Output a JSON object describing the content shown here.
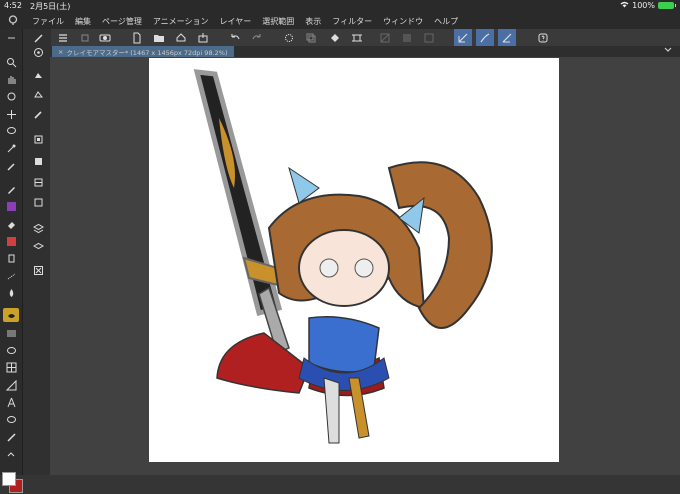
{
  "status": {
    "time": "4:52",
    "date": "2月5日(土)",
    "battery": "100%"
  },
  "menu": {
    "items": [
      "ファイル",
      "編集",
      "ページ管理",
      "アニメーション",
      "レイヤー",
      "選択範囲",
      "表示",
      "フィルター",
      "ウィンドウ",
      "ヘルプ"
    ]
  },
  "tab": {
    "title": "クレイモアマスター* (1467 x 1456px 72dpi 98.2%)"
  },
  "icons": {
    "app_logo": "clip-studio-logo-icon",
    "wifi": "wifi-icon",
    "battery": "battery-icon",
    "chevron": "chevron-down-icon"
  },
  "colors": {
    "accent": "#4a6fa5",
    "selected_tool": "#c9a227",
    "main_color": "#ffffff",
    "sub_color": "#b02020"
  }
}
